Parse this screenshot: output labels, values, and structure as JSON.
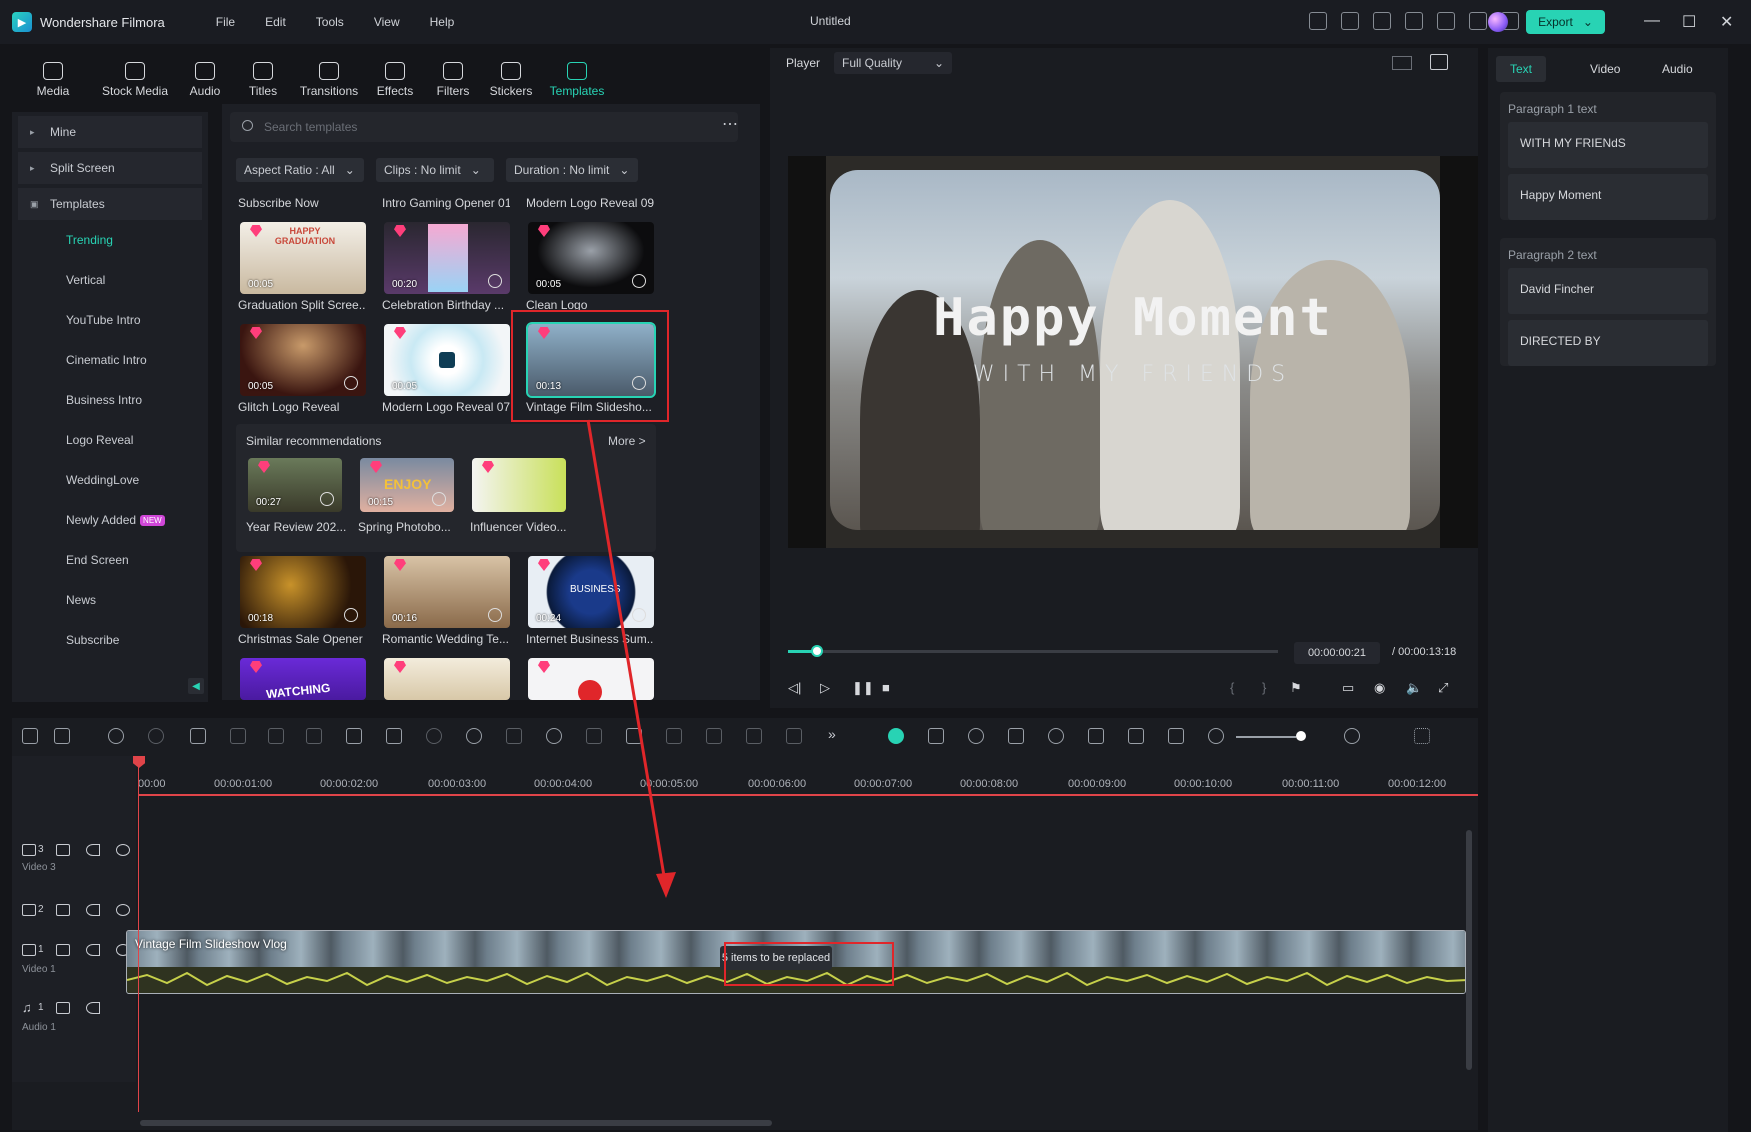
{
  "app": {
    "name": "Wondershare Filmora",
    "document_title": "Untitled",
    "export_label": "Export"
  },
  "menu": [
    "File",
    "Edit",
    "Tools",
    "View",
    "Help"
  ],
  "media_tabs": [
    {
      "label": "Media",
      "icon": "media-icon"
    },
    {
      "label": "Stock Media",
      "icon": "stock-media-icon"
    },
    {
      "label": "Audio",
      "icon": "music-note-icon"
    },
    {
      "label": "Titles",
      "icon": "text-t-icon"
    },
    {
      "label": "Transitions",
      "icon": "transition-icon"
    },
    {
      "label": "Effects",
      "icon": "sparkle-icon"
    },
    {
      "label": "Filters",
      "icon": "filter-icon"
    },
    {
      "label": "Stickers",
      "icon": "sticker-icon"
    },
    {
      "label": "Templates",
      "icon": "template-icon",
      "active": true
    }
  ],
  "sidebar": {
    "top_items": [
      "Mine",
      "Split Screen",
      "Templates"
    ],
    "sub_items": [
      "Trending",
      "Vertical",
      "YouTube Intro",
      "Cinematic Intro",
      "Business Intro",
      "Logo Reveal",
      "WeddingLove",
      "Newly Added",
      "End Screen",
      "News",
      "Subscribe"
    ],
    "new_badge": "NEW"
  },
  "search": {
    "placeholder": "Search templates"
  },
  "filters": [
    "Aspect Ratio : All",
    "Clips : No limit",
    "Duration : No limit"
  ],
  "row0_titles": [
    "Subscribe Now",
    "Intro Gaming Opener 01",
    "Modern Logo Reveal 09"
  ],
  "templates": [
    {
      "title": "Graduation Split Scree...",
      "duration": "00:05"
    },
    {
      "title": "Celebration Birthday ...",
      "duration": "00:20"
    },
    {
      "title": "Clean Logo",
      "duration": "00:05"
    },
    {
      "title": "Glitch Logo Reveal",
      "duration": "00:05"
    },
    {
      "title": "Modern Logo Reveal 07",
      "duration": "00:05"
    },
    {
      "title": "Vintage Film Slidesho...",
      "duration": "00:13"
    },
    {
      "title": "Christmas Sale Opener",
      "duration": "00:18"
    },
    {
      "title": "Romantic Wedding Te...",
      "duration": "00:16"
    },
    {
      "title": "Internet Business Sum...",
      "duration": "00:24"
    }
  ],
  "thumb_text": {
    "graduation": "HAPPY GRADUATION",
    "enjoy": "ENJOY",
    "business": "BUSINESS",
    "watching": "WATCHING"
  },
  "similar": {
    "heading": "Similar recommendations",
    "more": "More >",
    "items": [
      {
        "title": "Year Review 202...",
        "duration": "00:27"
      },
      {
        "title": "Spring Photobo...",
        "duration": "00:15"
      },
      {
        "title": "Influencer Video...",
        "duration": ""
      }
    ]
  },
  "player": {
    "label": "Player",
    "quality": "Full Quality",
    "preview_title": "Happy Moment",
    "preview_subtitle": "WITH MY FRIENDS",
    "current_time": "00:00:00:21",
    "total_time": "/ 00:00:13:18",
    "progress_fraction": 0.06
  },
  "right_panel": {
    "tabs": [
      "Text",
      "Video",
      "Audio"
    ],
    "groups": [
      {
        "label": "Paragraph 1 text",
        "fields": [
          "WITH MY FRIENdS",
          "Happy Moment"
        ]
      },
      {
        "label": "Paragraph 2 text",
        "fields": [
          "David Fincher",
          "DIRECTED BY"
        ]
      }
    ]
  },
  "timeline": {
    "ticks": [
      "00:00",
      "00:00:01:00",
      "00:00:02:00",
      "00:00:03:00",
      "00:00:04:00",
      "00:00:05:00",
      "00:00:06:00",
      "00:00:07:00",
      "00:00:08:00",
      "00:00:09:00",
      "00:00:10:00",
      "00:00:11:00",
      "00:00:12:00"
    ],
    "tracks": [
      {
        "num": "3",
        "name": "Video 3"
      },
      {
        "num": "2",
        "name": ""
      },
      {
        "num": "1",
        "name": "Video 1"
      },
      {
        "num": "1",
        "name": "Audio 1"
      }
    ],
    "clip_label": "Vintage Film Slideshow Vlog",
    "replace_label": "5 items to be replaced"
  },
  "colors": {
    "accent": "#28d3b4",
    "highlight_box": "#e0262a",
    "playhead": "#e04449"
  }
}
